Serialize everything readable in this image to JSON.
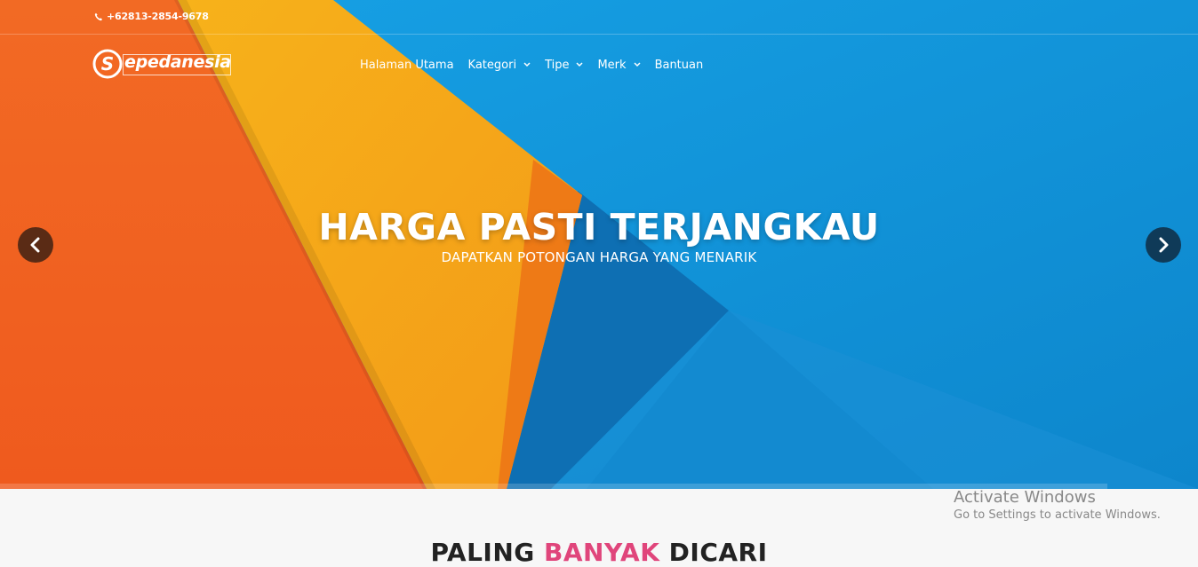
{
  "topbar": {
    "phone": "+62813-2854-9678",
    "phone_icon": "phone-icon"
  },
  "brand": {
    "initial": "S",
    "name": "epedanesia"
  },
  "nav": {
    "items": [
      {
        "label": "Halaman Utama",
        "dropdown": false
      },
      {
        "label": "Kategori",
        "dropdown": true
      },
      {
        "label": "Tipe",
        "dropdown": true
      },
      {
        "label": "Merk",
        "dropdown": true
      },
      {
        "label": "Bantuan",
        "dropdown": false
      }
    ],
    "chevron": "⌄"
  },
  "hero": {
    "title": "HARGA PASTI TERJANGKAU",
    "subtitle": "DAPATKAN POTONGAN HARGA YANG MENARIK",
    "prev_icon": "chevron-left-icon",
    "next_icon": "chevron-right-icon",
    "colors": {
      "orange": "#f26a22",
      "yellow": "#f5a81c",
      "blue": "#1597dc",
      "deep_blue": "#0f73b7"
    }
  },
  "section": {
    "title_pre": "PALING ",
    "title_accent": "BANYAK",
    "title_post": " DICARI"
  },
  "watermark": {
    "line1": "Activate Windows",
    "line2": "Go to Settings to activate Windows."
  }
}
